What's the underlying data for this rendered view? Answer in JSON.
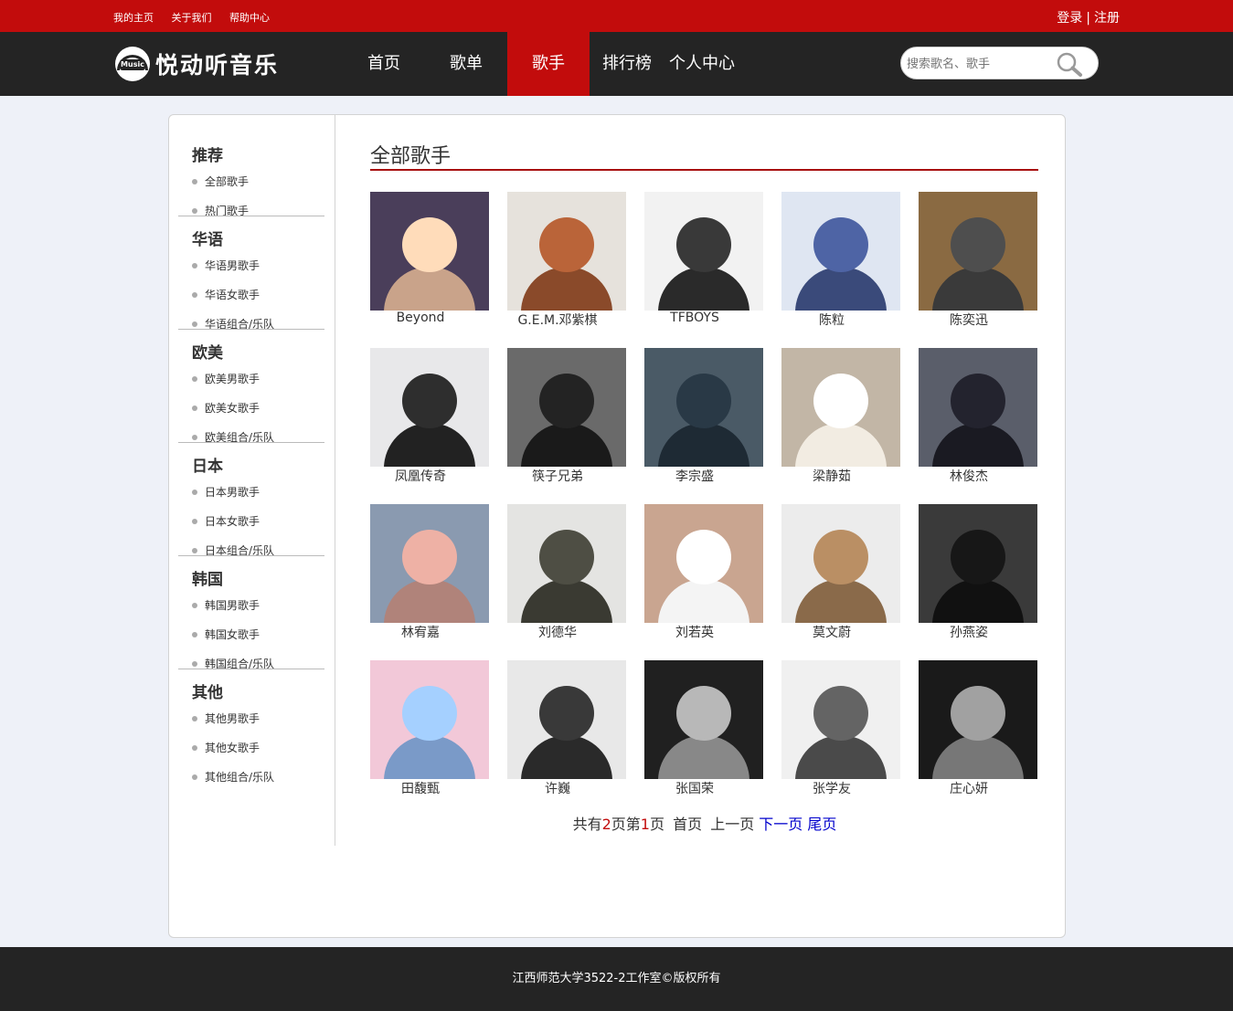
{
  "topbar": {
    "links": [
      "我的主页",
      "关于我们",
      "帮助中心"
    ],
    "login": "登录",
    "separator": "|",
    "register": "注册"
  },
  "nav": {
    "logo_badge": "Music",
    "logo_text": "悦动听音乐",
    "tabs": [
      "首页",
      "歌单",
      "歌手",
      "排行榜",
      "个人中心"
    ],
    "active_tab": "歌手",
    "search_placeholder": "搜索歌名、歌手",
    "search_icon": "magnifier-icon"
  },
  "sidebar": {
    "groups": [
      {
        "title": "推荐",
        "items": [
          "全部歌手",
          "热门歌手"
        ]
      },
      {
        "title": "华语",
        "items": [
          "华语男歌手",
          "华语女歌手",
          "华语组合/乐队"
        ]
      },
      {
        "title": "欧美",
        "items": [
          "欧美男歌手",
          "欧美女歌手",
          "欧美组合/乐队"
        ]
      },
      {
        "title": "日本",
        "items": [
          "日本男歌手",
          "日本女歌手",
          "日本组合/乐队"
        ]
      },
      {
        "title": "韩国",
        "items": [
          "韩国男歌手",
          "韩国女歌手",
          "韩国组合/乐队"
        ]
      },
      {
        "title": "其他",
        "items": [
          "其他男歌手",
          "其他女歌手",
          "其他组合/乐队"
        ]
      }
    ]
  },
  "main": {
    "title": "全部歌手",
    "singers": [
      {
        "name": "Beyond",
        "bg": "#4a3e5a",
        "fg": "#c9a38a"
      },
      {
        "name": "G.E.M.邓紫棋",
        "bg": "#e6e2dc",
        "fg": "#8a4a2a"
      },
      {
        "name": "TFBOYS",
        "bg": "#f2f2f2",
        "fg": "#2a2a2a"
      },
      {
        "name": "陈粒",
        "bg": "#dfe6f2",
        "fg": "#3a4a7a"
      },
      {
        "name": "陈奕迅",
        "bg": "#8a6a42",
        "fg": "#3a3a3a"
      },
      {
        "name": "凤凰传奇",
        "bg": "#e8e8ea",
        "fg": "#222"
      },
      {
        "name": "筷子兄弟",
        "bg": "#6a6a6a",
        "fg": "#1a1a1a"
      },
      {
        "name": "李宗盛",
        "bg": "#4a5a66",
        "fg": "#1e2a34"
      },
      {
        "name": "梁静茹",
        "bg": "#c2b6a6",
        "fg": "#f2ece2"
      },
      {
        "name": "林俊杰",
        "bg": "#5a5e6a",
        "fg": "#1a1a22"
      },
      {
        "name": "林宥嘉",
        "bg": "#8a9ab0",
        "fg": "#b0837a"
      },
      {
        "name": "刘德华",
        "bg": "#e4e4e2",
        "fg": "#3a3a32"
      },
      {
        "name": "刘若英",
        "bg": "#c9a590",
        "fg": "#f4f4f4"
      },
      {
        "name": "莫文蔚",
        "bg": "#ececec",
        "fg": "#8a6a4a"
      },
      {
        "name": "孙燕姿",
        "bg": "#3a3a3a",
        "fg": "#111"
      },
      {
        "name": "田馥甄",
        "bg": "#f2c8d8",
        "fg": "#7a9ac8"
      },
      {
        "name": "许巍",
        "bg": "#e8e8e8",
        "fg": "#2a2a2a"
      },
      {
        "name": "张国荣",
        "bg": "#202020",
        "fg": "#888"
      },
      {
        "name": "张学友",
        "bg": "#f0f0f0",
        "fg": "#4a4a4a"
      },
      {
        "name": "庄心妍",
        "bg": "#1a1a1a",
        "fg": "#777"
      }
    ]
  },
  "pager": {
    "prefix": "共有",
    "total_pages": "2",
    "mid": "页第",
    "current_page": "1",
    "suffix": "页",
    "first": "首页",
    "prev": "上一页",
    "next": "下一页",
    "last": "尾页"
  },
  "footer": {
    "text": "江西师范大学3522-2工作室©版权所有"
  },
  "colors": {
    "brand_red": "#c20c0c",
    "dark_bar": "#242424",
    "title_underline": "#a81010",
    "link_blue": "#0000cc"
  }
}
